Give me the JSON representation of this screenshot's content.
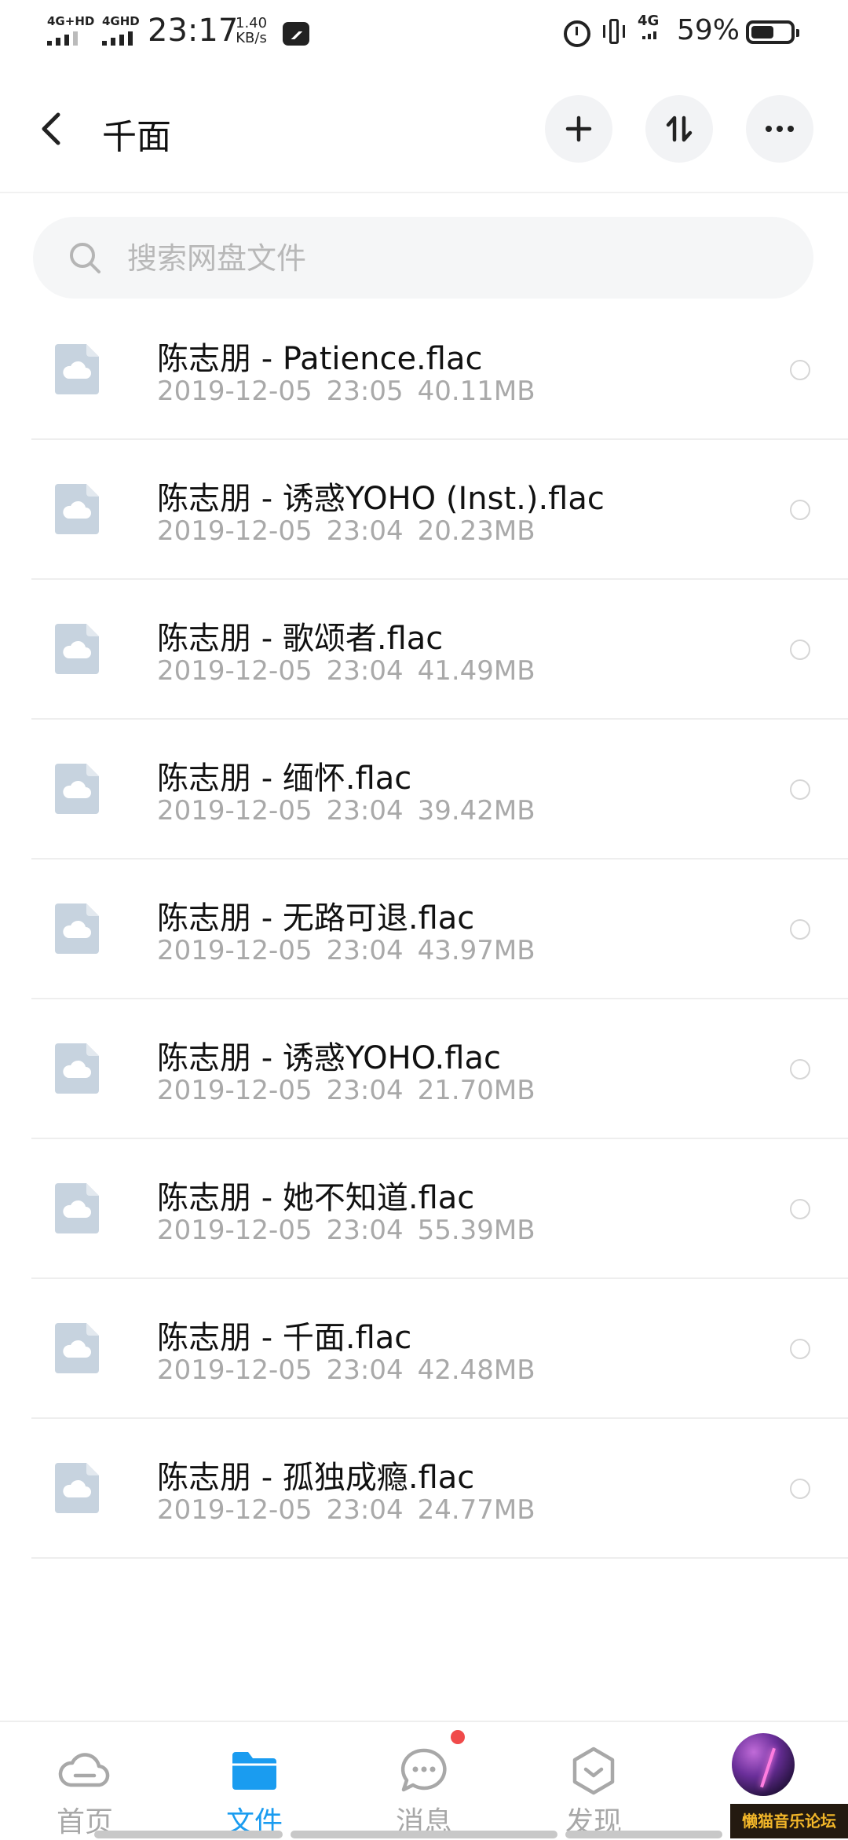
{
  "status_bar": {
    "sim1": "4G+HD",
    "sim2": "4GHD",
    "time": "23:17",
    "speed_value": "1.40",
    "speed_unit": "KB/s",
    "network": "4G",
    "battery": "59%",
    "battery_level": 0.59
  },
  "header": {
    "title": "千面",
    "back_icon": "back-arrow-icon",
    "add_icon": "plus-icon",
    "sort_icon": "sort-icon",
    "more_icon": "more-dots-icon"
  },
  "search": {
    "placeholder": "搜索网盘文件",
    "value": ""
  },
  "files": [
    {
      "name": "陈志朋 - Patience.flac",
      "date": "2019-12-05",
      "time": "23:05",
      "size": "40.11MB"
    },
    {
      "name": "陈志朋 - 诱惑YOHO (Inst.).flac",
      "date": "2019-12-05",
      "time": "23:04",
      "size": "20.23MB"
    },
    {
      "name": "陈志朋 - 歌颂者.flac",
      "date": "2019-12-05",
      "time": "23:04",
      "size": "41.49MB"
    },
    {
      "name": "陈志朋 - 缅怀.flac",
      "date": "2019-12-05",
      "time": "23:04",
      "size": "39.42MB"
    },
    {
      "name": "陈志朋 - 无路可退.flac",
      "date": "2019-12-05",
      "time": "23:04",
      "size": "43.97MB"
    },
    {
      "name": "陈志朋 - 诱惑YOHO.flac",
      "date": "2019-12-05",
      "time": "23:04",
      "size": "21.70MB"
    },
    {
      "name": "陈志朋 - 她不知道.flac",
      "date": "2019-12-05",
      "time": "23:04",
      "size": "55.39MB"
    },
    {
      "name": "陈志朋 - 千面.flac",
      "date": "2019-12-05",
      "time": "23:04",
      "size": "42.48MB"
    },
    {
      "name": "陈志朋 - 孤独成瘾.flac",
      "date": "2019-12-05",
      "time": "23:04",
      "size": "24.77MB"
    }
  ],
  "bottom_nav": {
    "tabs": [
      {
        "label": "首页",
        "icon": "cloud-icon"
      },
      {
        "label": "文件",
        "icon": "folder-icon"
      },
      {
        "label": "消息",
        "icon": "chat-bubble-icon"
      },
      {
        "label": "发现",
        "icon": "discover-cube-icon"
      },
      {
        "label": "",
        "icon": "avatar"
      }
    ],
    "active_tab": "文件",
    "messages_has_badge": true
  },
  "watermark": "懒猫音乐论坛",
  "colors": {
    "accent": "#1a9cf0",
    "badge": "#f04a4a",
    "file_icon": "#c7d3df",
    "secondary_text": "#a9a9a9"
  }
}
